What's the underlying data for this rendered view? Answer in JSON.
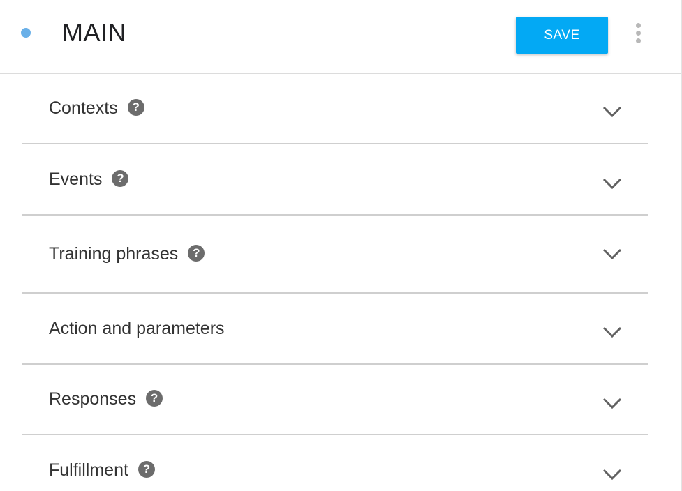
{
  "header": {
    "title": "MAIN",
    "save_label": "SAVE",
    "status_color": "#6ab0e8",
    "accent_color": "#03a9f4",
    "more_icon": "more-vert-icon"
  },
  "sections": [
    {
      "label": "Contexts",
      "has_help": true,
      "help_glyph": "?"
    },
    {
      "label": "Events",
      "has_help": true,
      "help_glyph": "?"
    },
    {
      "label": "Training phrases",
      "has_help": true,
      "help_glyph": "?"
    },
    {
      "label": "Action and parameters",
      "has_help": false
    },
    {
      "label": "Responses",
      "has_help": true,
      "help_glyph": "?"
    },
    {
      "label": "Fulfillment",
      "has_help": true,
      "help_glyph": "?"
    }
  ],
  "icons": {
    "help": "help-circle-icon",
    "expand": "chevron-down-icon"
  }
}
